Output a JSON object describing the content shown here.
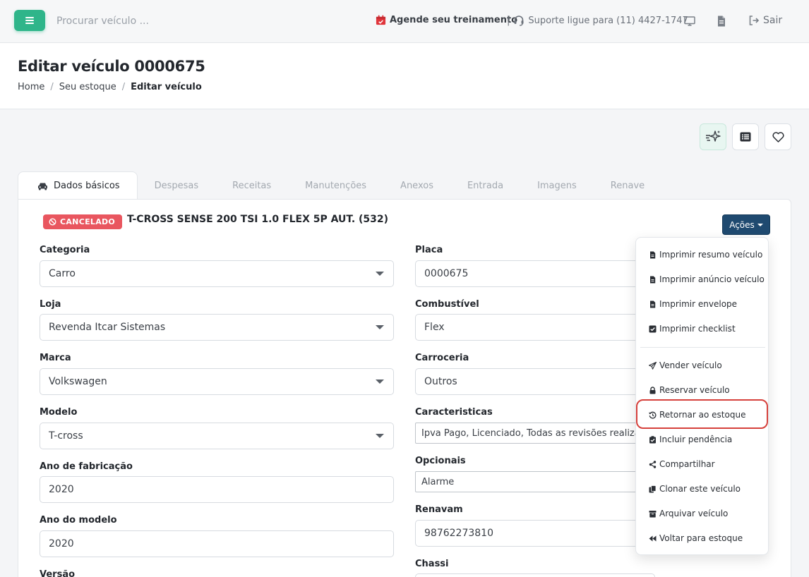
{
  "topbar": {
    "search_placeholder": "Procurar veículo ...",
    "training_label": "Agende seu treinamento",
    "separator": "|",
    "support_label": "Suporte ligue para (11) 4427-1747",
    "logout_label": "Sair",
    "training_color": "#e0353b"
  },
  "header": {
    "title": "Editar veículo 0000675",
    "breadcrumb": [
      "Home",
      "Seu estoque",
      "Editar veículo"
    ],
    "breadcrumb_sep": "/"
  },
  "tabs": [
    {
      "label": "Dados básicos",
      "active": true
    },
    {
      "label": "Despesas"
    },
    {
      "label": "Receitas"
    },
    {
      "label": "Manutenções"
    },
    {
      "label": "Anexos"
    },
    {
      "label": "Entrada"
    },
    {
      "label": "Imagens"
    },
    {
      "label": "Renave"
    }
  ],
  "vehicle": {
    "status_badge": "CANCELADO",
    "title": "T-CROSS SENSE 200 TSI 1.0 FLEX 5P AUT. (532)",
    "actions_label": "Ações"
  },
  "form": {
    "categoria": {
      "label": "Categoria",
      "value": "Carro"
    },
    "loja": {
      "label": "Loja",
      "value": "Revenda Itcar Sistemas"
    },
    "marca": {
      "label": "Marca",
      "value": "Volkswagen"
    },
    "modelo": {
      "label": "Modelo",
      "value": "T-cross"
    },
    "ano_fabricacao": {
      "label": "Ano de fabricação",
      "value": "2020"
    },
    "ano_modelo": {
      "label": "Ano do modelo",
      "value": "2020"
    },
    "versao": {
      "label": "Versão"
    },
    "placa": {
      "label": "Placa",
      "value": "0000675"
    },
    "combustivel": {
      "label": "Combustível",
      "value": "Flex"
    },
    "carroceria": {
      "label": "Carroceria",
      "value": "Outros"
    },
    "caracteristicas": {
      "label": "Caracteristicas",
      "value": "Ipva Pago, Licenciado, Todas as revisões realizadas"
    },
    "opcionais": {
      "label": "Opcionais",
      "value": "Alarme"
    },
    "renavam": {
      "label": "Renavam",
      "value": "98762273810"
    },
    "chassi": {
      "label": "Chassi"
    }
  },
  "actions_menu": {
    "items": [
      {
        "label": "Imprimir resumo veículo",
        "icon": "file-icon"
      },
      {
        "label": "Imprimir anúncio veículo",
        "icon": "file-icon"
      },
      {
        "label": "Imprimir envelope",
        "icon": "file-icon"
      },
      {
        "label": "Imprimir checklist",
        "icon": "check-square-icon"
      },
      {
        "label": "Vender veículo",
        "icon": "paper-plane-icon"
      },
      {
        "label": "Reservar veículo",
        "icon": "lock-icon"
      },
      {
        "label": "Retornar ao estoque",
        "icon": "history-icon",
        "highlighted": true
      },
      {
        "label": "Incluir pendência",
        "icon": "clipboard-check-icon"
      },
      {
        "label": "Compartilhar",
        "icon": "share-icon"
      },
      {
        "label": "Clonar este veículo",
        "icon": "copy-icon"
      },
      {
        "label": "Arquivar veículo",
        "icon": "archive-icon"
      },
      {
        "label": "Voltar para estoque",
        "icon": "backward-icon"
      }
    ],
    "highlight_color": "#d6413c"
  }
}
